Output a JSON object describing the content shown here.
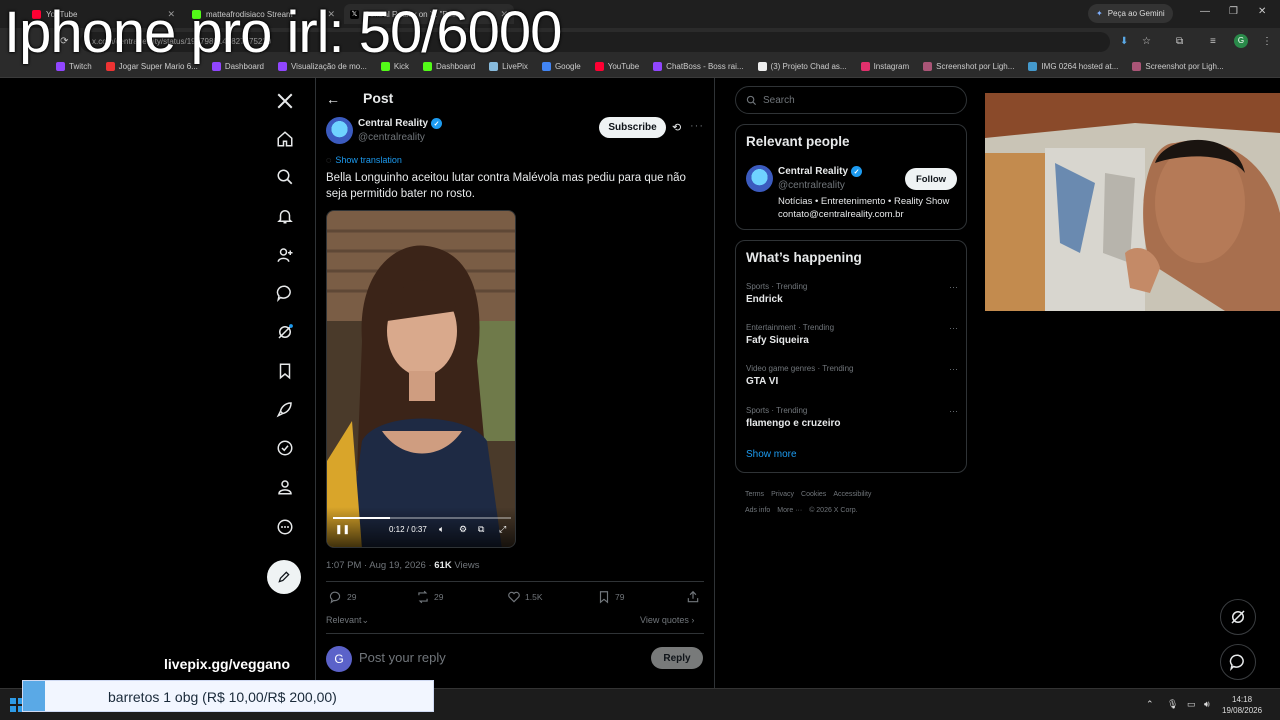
{
  "overlay": {
    "title": "Iphone pro irl: 50/6000",
    "livepix": "livepix.gg/veggano",
    "donation": "barretos 1 obg (R$ 10,00/R$ 200,00)"
  },
  "browser": {
    "tabs": [
      {
        "label": "YouTube",
        "color": "#ff0033"
      },
      {
        "label": "matteafrodisiaco Stream",
        "color": "#53fc18"
      },
      {
        "label": "Central Reality on X: \"Bella",
        "color": "#e7e9ea"
      }
    ],
    "gemini_label": "Peça ao Gemini",
    "url": "x.com/centralreality/status/1957985145827475220",
    "profile_initial": "G",
    "bookmarks": [
      {
        "label": "Twitch",
        "color": "#9146ff"
      },
      {
        "label": "Jogar Super Mario 6...",
        "color": "#e33"
      },
      {
        "label": "Dashboard",
        "color": "#9146ff"
      },
      {
        "label": "Visualização de mo...",
        "color": "#9146ff"
      },
      {
        "label": "Kick",
        "color": "#53fc18"
      },
      {
        "label": "Dashboard",
        "color": "#53fc18"
      },
      {
        "label": "LivePix",
        "color": "#8bd"
      },
      {
        "label": "Google",
        "color": "#4285f4"
      },
      {
        "label": "YouTube",
        "color": "#ff0033"
      },
      {
        "label": "ChatBoss - Boss rai...",
        "color": "#9146ff"
      },
      {
        "label": "(3) Projeto Chad as...",
        "color": "#eee"
      },
      {
        "label": "Instagram",
        "color": "#e1306c"
      },
      {
        "label": "Screenshot por Ligh...",
        "color": "#a57"
      },
      {
        "label": "IMG 0264 hosted at...",
        "color": "#49c"
      },
      {
        "label": "Screenshot por Ligh...",
        "color": "#a57"
      }
    ]
  },
  "post": {
    "header_title": "Post",
    "author_name": "Central Reality",
    "author_handle": "@centralreality",
    "subscribe_label": "Subscribe",
    "show_translation": "Show translation",
    "text": "Bella Longuinho aceitou lutar contra Malévola mas pediu para que não seja permitido bater no rosto.",
    "video_time": "0:12 / 0:37",
    "video_progress": 0.32,
    "timestamp": "1:07 PM · Aug 19, 2026 · ",
    "views_count": "61K",
    "views_label": " Views",
    "replies": "29",
    "reposts": "29",
    "likes": "1.5K",
    "bookmarks": "79",
    "relevant_label": "Relevant",
    "view_quotes": "View quotes",
    "reply_avatar": "G",
    "reply_placeholder": "Post your reply",
    "reply_button": "Reply"
  },
  "sidebar": {
    "search_placeholder": "Search",
    "relevant_title": "Relevant people",
    "person_name": "Central Reality",
    "person_handle": "@centralreality",
    "follow_label": "Follow",
    "person_bio": "Notícias • Entretenimento • Reality Show contato@centralreality.com.br",
    "happening_title": "What’s happening",
    "trends": [
      {
        "category": "Sports · Trending",
        "name": "Endrick"
      },
      {
        "category": "Entertainment · Trending",
        "name": "Fafy Siqueira"
      },
      {
        "category": "Video game genres · Trending",
        "name": "GTA VI"
      },
      {
        "category": "Sports · Trending",
        "name": "flamengo e cruzeiro"
      }
    ],
    "show_more": "Show more",
    "footer": [
      "Terms",
      "Privacy",
      "Cookies",
      "Accessibility",
      "Ads info",
      "More ···",
      "© 2026 X Corp."
    ]
  },
  "taskbar": {
    "time": "14:18",
    "date": "19/08/2026"
  },
  "colors": {
    "accent": "#1d9bf0",
    "background": "#000000",
    "border": "#2f3336"
  }
}
